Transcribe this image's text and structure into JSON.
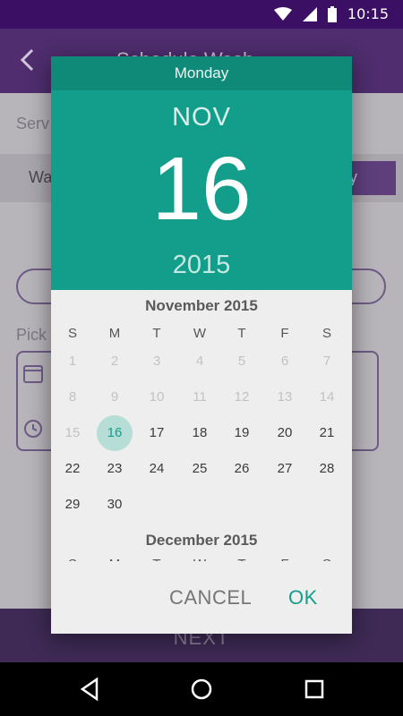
{
  "status_bar": {
    "time": "10:15"
  },
  "background": {
    "title": "Schedule Wash",
    "service_label": "Serv",
    "row_text": "Wa",
    "row_button": "nly",
    "pick_label": "Pick",
    "field_1": "",
    "field_2": "",
    "next_label": "NEXT"
  },
  "dialog": {
    "day_name": "Monday",
    "month": "NOV",
    "date": "16",
    "year": "2015",
    "calendar_title": "November 2015",
    "weekdays": [
      "S",
      "M",
      "T",
      "W",
      "T",
      "F",
      "S"
    ],
    "weeks": [
      [
        "1",
        "2",
        "3",
        "4",
        "5",
        "6",
        "7"
      ],
      [
        "8",
        "9",
        "10",
        "11",
        "12",
        "13",
        "14"
      ],
      [
        "15",
        "16",
        "17",
        "18",
        "19",
        "20",
        "21"
      ],
      [
        "22",
        "23",
        "24",
        "25",
        "26",
        "27",
        "28"
      ],
      [
        "29",
        "30",
        "",
        "",
        "",
        "",
        ""
      ]
    ],
    "selected_day": "16",
    "next_calendar_title": "December 2015",
    "cancel_label": "CANCEL",
    "ok_label": "OK"
  },
  "colors": {
    "accent": "#139e8b",
    "accent_dark": "#0f8a79",
    "app_bar": "#4f2d6e",
    "status_bar": "#3b0f63"
  }
}
